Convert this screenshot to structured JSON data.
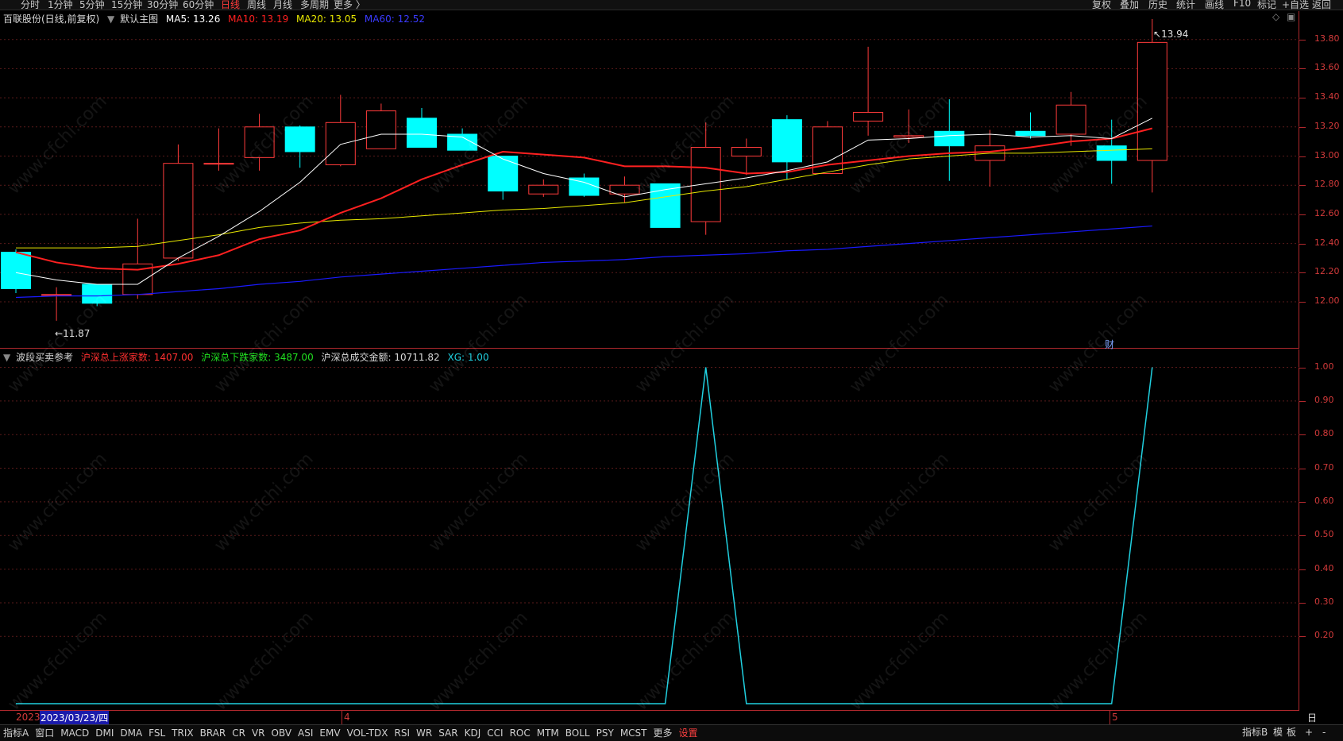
{
  "toolbar": {
    "periods": [
      "分时",
      "1分钟",
      "5分钟",
      "15分钟",
      "30分钟",
      "60分钟",
      "日线",
      "周线",
      "月线",
      "多周期",
      "更多 〉"
    ],
    "active_period": "日线",
    "right_buttons": [
      "复权",
      "叠加",
      "历史",
      "统计",
      "画线",
      "F10",
      "标记",
      "+自选",
      "返回"
    ]
  },
  "main_info": {
    "stock": "百联股份(日线,前复权)",
    "chart_name": "默认主图",
    "ma5": "MA5: 13.26",
    "ma10": "MA10: 13.19",
    "ma20": "MA20: 13.05",
    "ma60": "MA60: 12.52"
  },
  "sub_info": {
    "indicator": "波段买卖参考",
    "up_count": "沪深总上涨家数: 1407.00",
    "down_count": "沪深总下跌家数: 3487.00",
    "amount": "沪深总成交金额: 10711.82",
    "xg": "XG: 1.00"
  },
  "annotations": {
    "low_label": "11.87",
    "high_label": "13.94",
    "fin_badge": "财"
  },
  "main_axis": {
    "labels": [
      "13.80",
      "13.60",
      "13.40",
      "13.20",
      "13.00",
      "12.80",
      "12.60",
      "12.40",
      "12.20",
      "12.00"
    ]
  },
  "sub_axis": {
    "labels": [
      "1.00",
      "0.90",
      "0.80",
      "0.70",
      "0.60",
      "0.50",
      "0.40",
      "0.30",
      "0.20"
    ]
  },
  "date_axis": {
    "year": "2023",
    "cursor_date": "2023/03/23/四",
    "month_marks": [
      "4",
      "5"
    ],
    "period_label": "日线"
  },
  "bottom_tabs": [
    "指标A",
    "窗口",
    "MACD",
    "DMI",
    "DMA",
    "FSL",
    "TRIX",
    "BRAR",
    "CR",
    "VR",
    "OBV",
    "ASI",
    "EMV",
    "VOL-TDX",
    "RSI",
    "WR",
    "SAR",
    "KDJ",
    "CCI",
    "ROC",
    "MTM",
    "BOLL",
    "PSY",
    "MCST",
    "更多",
    "设置"
  ],
  "bottom_right": [
    "指标B",
    "模",
    "板",
    "+",
    "-"
  ],
  "watermark": "www.cfchi.com",
  "colors": {
    "up": "#ff3b3b",
    "down": "#00ffff",
    "ma5": "#ffffff",
    "ma10": "#ff2020",
    "ma20": "#e8e800",
    "ma60": "#1a1aff",
    "xg_line": "#20d0e0",
    "axis": "#b0282d"
  },
  "chart_data": [
    {
      "type": "candlestick",
      "ylim": [
        11.85,
        13.98
      ],
      "candles": [
        {
          "o": 12.34,
          "c": 12.09,
          "h": 12.36,
          "l": 12.06
        },
        {
          "o": 12.05,
          "c": 12.05,
          "h": 12.1,
          "l": 11.87
        },
        {
          "o": 12.12,
          "c": 11.99,
          "h": 12.12,
          "l": 11.97
        },
        {
          "o": 12.05,
          "c": 12.26,
          "h": 12.57,
          "l": 12.02
        },
        {
          "o": 12.3,
          "c": 12.95,
          "h": 13.08,
          "l": 12.28
        },
        {
          "o": 12.95,
          "c": 12.95,
          "h": 13.19,
          "l": 12.9
        },
        {
          "o": 12.99,
          "c": 13.2,
          "h": 13.29,
          "l": 12.9
        },
        {
          "o": 13.2,
          "c": 13.03,
          "h": 13.21,
          "l": 12.92
        },
        {
          "o": 12.94,
          "c": 13.23,
          "h": 13.42,
          "l": 12.93
        },
        {
          "o": 13.05,
          "c": 13.31,
          "h": 13.36,
          "l": 13.05
        },
        {
          "o": 13.26,
          "c": 13.06,
          "h": 13.33,
          "l": 13.06
        },
        {
          "o": 13.15,
          "c": 13.04,
          "h": 13.19,
          "l": 13.04
        },
        {
          "o": 13.0,
          "c": 12.76,
          "h": 13.0,
          "l": 12.7
        },
        {
          "o": 12.74,
          "c": 12.8,
          "h": 12.84,
          "l": 12.72
        },
        {
          "o": 12.85,
          "c": 12.73,
          "h": 12.88,
          "l": 12.72
        },
        {
          "o": 12.74,
          "c": 12.8,
          "h": 12.86,
          "l": 12.68
        },
        {
          "o": 12.81,
          "c": 12.51,
          "h": 12.81,
          "l": 12.51
        },
        {
          "o": 12.55,
          "c": 13.06,
          "h": 13.23,
          "l": 12.46
        },
        {
          "o": 13.0,
          "c": 13.06,
          "h": 13.12,
          "l": 12.87
        },
        {
          "o": 13.25,
          "c": 12.96,
          "h": 13.28,
          "l": 12.84
        },
        {
          "o": 12.88,
          "c": 13.2,
          "h": 13.24,
          "l": 12.88
        },
        {
          "o": 13.24,
          "c": 13.3,
          "h": 13.75,
          "l": 13.14
        },
        {
          "o": 13.13,
          "c": 13.14,
          "h": 13.32,
          "l": 13.09
        },
        {
          "o": 13.17,
          "c": 13.07,
          "h": 13.39,
          "l": 12.83
        },
        {
          "o": 12.97,
          "c": 13.07,
          "h": 13.18,
          "l": 12.79
        },
        {
          "o": 13.17,
          "c": 13.14,
          "h": 13.3,
          "l": 13.12
        },
        {
          "o": 13.15,
          "c": 13.35,
          "h": 13.44,
          "l": 13.07
        },
        {
          "o": 13.07,
          "c": 12.97,
          "h": 13.25,
          "l": 12.81
        },
        {
          "o": 12.97,
          "c": 13.78,
          "h": 13.94,
          "l": 12.75
        }
      ],
      "ma5": [
        12.2,
        12.15,
        12.12,
        12.12,
        12.3,
        12.45,
        12.62,
        12.82,
        13.08,
        13.15,
        13.15,
        13.13,
        12.98,
        12.88,
        12.82,
        12.72,
        12.77,
        12.81,
        12.85,
        12.9,
        12.96,
        13.11,
        13.12,
        13.14,
        13.15,
        13.13,
        13.14,
        13.12,
        13.26
      ],
      "ma10": [
        12.34,
        12.27,
        12.23,
        12.22,
        12.26,
        12.32,
        12.43,
        12.49,
        12.61,
        12.71,
        12.84,
        12.94,
        13.03,
        13.01,
        12.99,
        12.93,
        12.93,
        12.92,
        12.88,
        12.89,
        12.94,
        12.97,
        13.0,
        13.02,
        13.03,
        13.06,
        13.1,
        13.12,
        13.19
      ],
      "ma20": [
        12.37,
        12.37,
        12.37,
        12.38,
        12.42,
        12.46,
        12.51,
        12.54,
        12.56,
        12.57,
        12.59,
        12.61,
        12.63,
        12.64,
        12.66,
        12.68,
        12.72,
        12.76,
        12.79,
        12.84,
        12.89,
        12.94,
        12.98,
        13.0,
        13.02,
        13.02,
        13.03,
        13.04,
        13.05
      ],
      "ma60": [
        12.03,
        12.04,
        12.04,
        12.05,
        12.07,
        12.09,
        12.12,
        12.14,
        12.17,
        12.19,
        12.21,
        12.23,
        12.25,
        12.27,
        12.28,
        12.29,
        12.31,
        12.32,
        12.33,
        12.35,
        12.36,
        12.38,
        12.4,
        12.42,
        12.44,
        12.46,
        12.48,
        12.5,
        12.52
      ]
    },
    {
      "type": "line",
      "title": "XG",
      "ylim": [
        0,
        1.0
      ],
      "x": [
        0,
        1,
        2,
        3,
        4,
        5,
        6,
        7,
        8,
        9,
        10,
        11,
        12,
        13,
        14,
        15,
        16,
        17,
        18,
        19,
        20,
        21,
        22,
        23,
        24,
        25,
        26,
        27,
        28
      ],
      "values": [
        0,
        0,
        0,
        0,
        0,
        0,
        0,
        0,
        0,
        0,
        0,
        0,
        0,
        0,
        0,
        0,
        0,
        1,
        0,
        0,
        0,
        0,
        0,
        0,
        0,
        0,
        0,
        0,
        1
      ]
    }
  ]
}
